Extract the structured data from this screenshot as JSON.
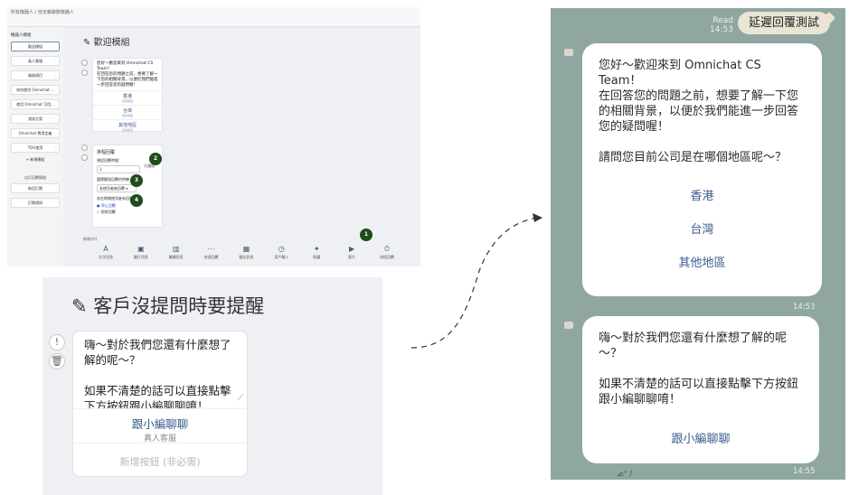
{
  "editor": {
    "breadcrumb": "所有機器人 / 自定義聊數機器人",
    "sidebar_title": "機器人模組",
    "sidebar_items": [
      "歡迎模組",
      "真人客服",
      "服務項目",
      "如何使用 Omnichat ...",
      "使用 Omnichat 可用...",
      "測試方案",
      "Omnichat 費用定義",
      "TOU使用"
    ],
    "add_module": "+ 新增模組",
    "section_title": "自訂回覆模組",
    "extra_items": [
      "新回訂閱",
      "訂閱通知"
    ],
    "heading": "歡迎模組",
    "card1_text": "您好～歡迎來到 Omnichat CS Team！\n在回答您的問題之前，想要了解一下您的相關背景，以便於我們能進一步回答您的疑問喔！",
    "card1_buttons": [
      {
        "label": "香港",
        "sub": "選項按鈕"
      },
      {
        "label": "台灣",
        "sub": "選項按鈕"
      },
      {
        "label": "其他地區",
        "sub": "選項按鈕"
      }
    ],
    "card2_title": "排程回覆",
    "card2_delay_label": "預設回覆時間：",
    "card2_delay_value": "1",
    "card2_unit": "分鐘後",
    "card2_select_label": "選擇觸發回覆的時機",
    "card2_select_value": "若使用者無回覆 ▾",
    "card2_radio_label": "若在期間使用者有回應",
    "card2_radio_1": "● 停止回覆",
    "card2_radio_2": "○ 照常回覆",
    "badges": [
      "1",
      "2",
      "3",
      "4"
    ],
    "toolbar_label": "新增卡片",
    "tools": [
      {
        "icon": "A",
        "label": "文字訊息"
      },
      {
        "icon": "▣",
        "label": "圖片訊息"
      },
      {
        "icon": "▥",
        "label": "輪播訊息"
      },
      {
        "icon": "⋯",
        "label": "快速回覆"
      },
      {
        "icon": "▦",
        "label": "圖文訊息"
      },
      {
        "icon": "◷",
        "label": "用戶輸入"
      },
      {
        "icon": "✦",
        "label": "貼圖"
      },
      {
        "icon": "▶",
        "label": "影片"
      },
      {
        "icon": "⏱",
        "label": "排程回覆"
      }
    ]
  },
  "zoom": {
    "title": "客戶沒提問時要提醒",
    "message": "嗨～對於我們您還有什麼想了解的呢～？\n\n如果不清楚的話可以直接點擊下方按鈕跟小編聊聊唷！",
    "button_label": "跟小編聊聊",
    "button_sub": "真人客服",
    "add_button": "新增按鈕 (非必需)"
  },
  "chat": {
    "read_label": "Read",
    "read_time": "14:53",
    "sent_message": "延遲回覆測試",
    "bubble1_text": "您好～歡迎來到 Omnichat CS Team！\n在回答您的問題之前，想要了解一下您的相關背景，以便於我們能進一步回答您的疑問喔！\n\n請問您目前公司是在哪個地區呢～？",
    "options": [
      "香港",
      "台灣",
      "其他地區"
    ],
    "bubble1_time": "14:53",
    "bubble2_text": "嗨～對於我們您還有什麼想了解的呢～？\n\n如果不清楚的話可以直接點擊下方按鈕跟小編聊聊唷！",
    "bubble2_button": "跟小編聊聊",
    "bubble2_time": "14:55"
  }
}
